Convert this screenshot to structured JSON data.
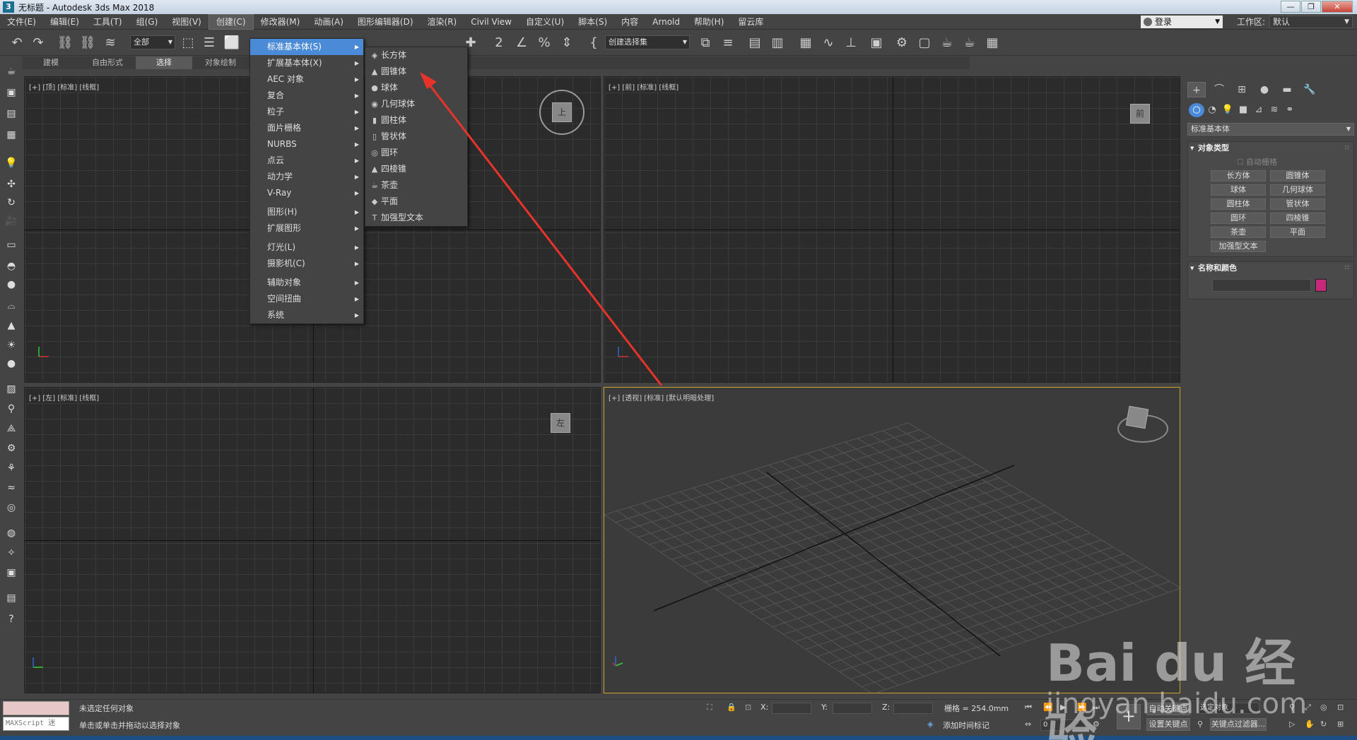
{
  "titlebar": {
    "app_icon": "3",
    "title": "无标题 - Autodesk 3ds Max 2018"
  },
  "menubar": {
    "items": [
      "文件(E)",
      "编辑(E)",
      "工具(T)",
      "组(G)",
      "视图(V)",
      "创建(C)",
      "修改器(M)",
      "动画(A)",
      "图形编辑器(D)",
      "渲染(R)",
      "Civil View",
      "自定义(U)",
      "脚本(S)",
      "内容",
      "Arnold",
      "帮助(H)",
      "留云库"
    ],
    "active_index": 5,
    "login": "登录",
    "workspace_label": "工作区:",
    "workspace_value": "默认"
  },
  "toolbar": {
    "filter_value": "全部",
    "selection_set_value": "创建选择集"
  },
  "ribbon": {
    "tabs": [
      "建模",
      "自由形式",
      "选择",
      "对象绘制"
    ],
    "active_index": 2
  },
  "viewports": {
    "top": {
      "label": "[+] [顶] [标准] [线框]",
      "gizmo": "上"
    },
    "front": {
      "label": "[+] [前] [标准] [线框]",
      "gizmo": "前"
    },
    "left": {
      "label": "[+] [左] [标准] [线框]",
      "gizmo": "左"
    },
    "perspective": {
      "label": "[+] [透视] [标准] [默认明暗处理]"
    }
  },
  "create_menu": {
    "items": [
      "标准基本体(S)",
      "扩展基本体(X)",
      "AEC 对象",
      "复合",
      "粒子",
      "面片栅格",
      "NURBS",
      "点云",
      "动力学",
      "V-Ray",
      "图形(H)",
      "扩展图形",
      "灯光(L)",
      "摄影机(C)",
      "辅助对象",
      "空间扭曲",
      "系统"
    ],
    "highlighted_index": 0
  },
  "primitives_menu": {
    "items": [
      "长方体",
      "圆锥体",
      "球体",
      "几何球体",
      "圆柱体",
      "管状体",
      "圆环",
      "四棱锥",
      "茶壶",
      "平面",
      "加强型文本"
    ],
    "icons": [
      "◈",
      "▲",
      "●",
      "◉",
      "▮",
      "▯",
      "◎",
      "▲",
      "☕",
      "◆",
      "T"
    ]
  },
  "command_panel": {
    "dropdown": "标准基本体",
    "object_type_title": "对象类型",
    "autogrid": "自动栅格",
    "buttons": [
      "长方体",
      "圆锥体",
      "球体",
      "几何球体",
      "圆柱体",
      "管状体",
      "圆环",
      "四棱锥",
      "茶壶",
      "平面",
      "加强型文本"
    ],
    "name_color_title": "名称和颜色",
    "object_color": "#c8287a"
  },
  "statusbar": {
    "maxscript": "MAXScript 迷",
    "status_line": "未选定任何对象",
    "prompt_line": "单击或单击并拖动以选择对象",
    "x_label": "X:",
    "y_label": "Y:",
    "z_label": "Z:",
    "grid": "栅格 = 254.0mm",
    "add_time_tag": "添加时间标记",
    "auto_key": "自动关键点",
    "set_key": "设置关键点",
    "selected_object": "选定对象",
    "key_filters": "关键点过滤器...",
    "frame_value": "0"
  },
  "watermark": {
    "brand": "Bai du 经验",
    "url": "jingyan.baidu.com"
  },
  "colors": {
    "accent": "#4a8ad6",
    "annotation": "#e8332a",
    "viewport_active_border": "#c9a227"
  }
}
